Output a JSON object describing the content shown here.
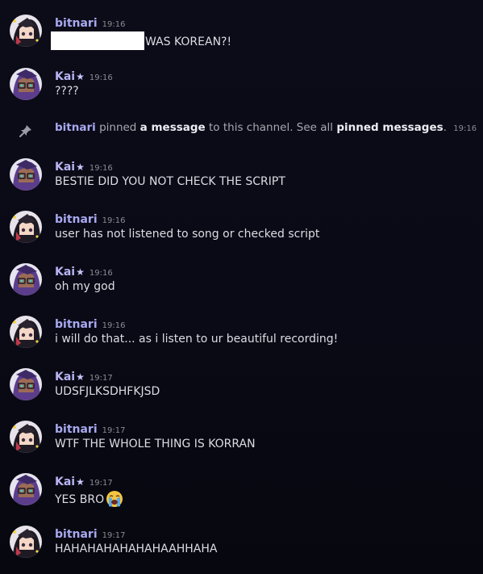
{
  "users": {
    "bitnari": {
      "name": "bitnari",
      "color": "#a8a9f0"
    },
    "kai": {
      "name": "Kai",
      "badge": "★",
      "color": "#b7b4f2"
    }
  },
  "messages": [
    {
      "user": "bitnari",
      "name": "bitnari",
      "time": "19:16",
      "text": "WAS KOREAN?!",
      "redacted_prefix": true
    },
    {
      "user": "kai",
      "name": "Kai",
      "time": "19:16",
      "text": "????"
    },
    {
      "user": "kai",
      "name": "Kai",
      "time": "19:16",
      "text": "BESTIE DID YOU NOT CHECK THE SCRIPT"
    },
    {
      "user": "bitnari",
      "name": "bitnari",
      "time": "19:16",
      "text": "user has not listened to song or checked script"
    },
    {
      "user": "kai",
      "name": "Kai",
      "time": "19:16",
      "text": "oh my god"
    },
    {
      "user": "bitnari",
      "name": "bitnari",
      "time": "19:16",
      "text": "i will do that... as i listen to ur beautiful recording!"
    },
    {
      "user": "kai",
      "name": "Kai",
      "time": "19:17",
      "text": "UDSFJLKSDHFKJSD"
    },
    {
      "user": "bitnari",
      "name": "bitnari",
      "time": "19:17",
      "text": "WTF THE WHOLE THING IS KORRAN"
    },
    {
      "user": "kai",
      "name": "Kai",
      "time": "19:17",
      "text": "YES BRO",
      "emoji": "loudly-crying-face-emoji"
    },
    {
      "user": "bitnari",
      "name": "bitnari",
      "time": "19:17",
      "text": "HAHAHAHAHAHAHAAHHAHA"
    }
  ],
  "system_message": {
    "icon": "pin-icon",
    "user": "bitnari",
    "text_before": "pinned",
    "link_message": "a message",
    "text_middle": "to this channel. See all",
    "link_pinned": "pinned messages",
    "text_end": ".",
    "time": "19:16"
  }
}
